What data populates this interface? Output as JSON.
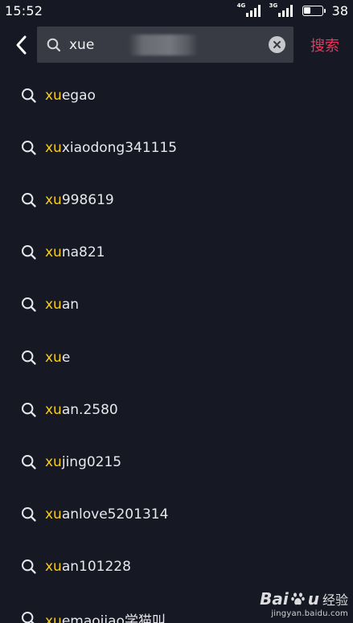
{
  "status_bar": {
    "time": "15:52",
    "signal1_label": "4G",
    "signal2_label": "3G",
    "battery_text": "38",
    "battery_level": 0.38
  },
  "header": {
    "back_icon": "chevron-left-icon",
    "search_icon": "search-icon",
    "search_value": "xue",
    "clear_icon": "close-circle-icon",
    "search_button_label": "搜索"
  },
  "colors": {
    "background": "#161823",
    "search_box": "#393b44",
    "highlight": "#face15",
    "accent": "#e8365c",
    "text": "#e8e8ec"
  },
  "suggestions": [
    {
      "icon": "search-icon",
      "highlight": "xu",
      "rest": "egao"
    },
    {
      "icon": "search-icon",
      "highlight": "xu",
      "rest": "xiaodong341115"
    },
    {
      "icon": "search-icon",
      "highlight": "xu",
      "rest": "998619"
    },
    {
      "icon": "search-icon",
      "highlight": "xu",
      "rest": "na821"
    },
    {
      "icon": "search-icon",
      "highlight": "xu",
      "rest": "an"
    },
    {
      "icon": "search-icon",
      "highlight": "xu",
      "rest": "e"
    },
    {
      "icon": "search-icon",
      "highlight": "xu",
      "rest": "an.2580"
    },
    {
      "icon": "search-icon",
      "highlight": "xu",
      "rest": "jing0215"
    },
    {
      "icon": "search-icon",
      "highlight": "xu",
      "rest": "anlove5201314"
    },
    {
      "icon": "search-icon",
      "highlight": "xu",
      "rest": "an101228"
    },
    {
      "icon": "search-icon",
      "highlight": "xu",
      "rest": "emaojiao学猫叫"
    }
  ],
  "watermark": {
    "brand": "Bai",
    "brand_end": "u",
    "sub": "经验",
    "url": "jingyan.baidu.com"
  }
}
